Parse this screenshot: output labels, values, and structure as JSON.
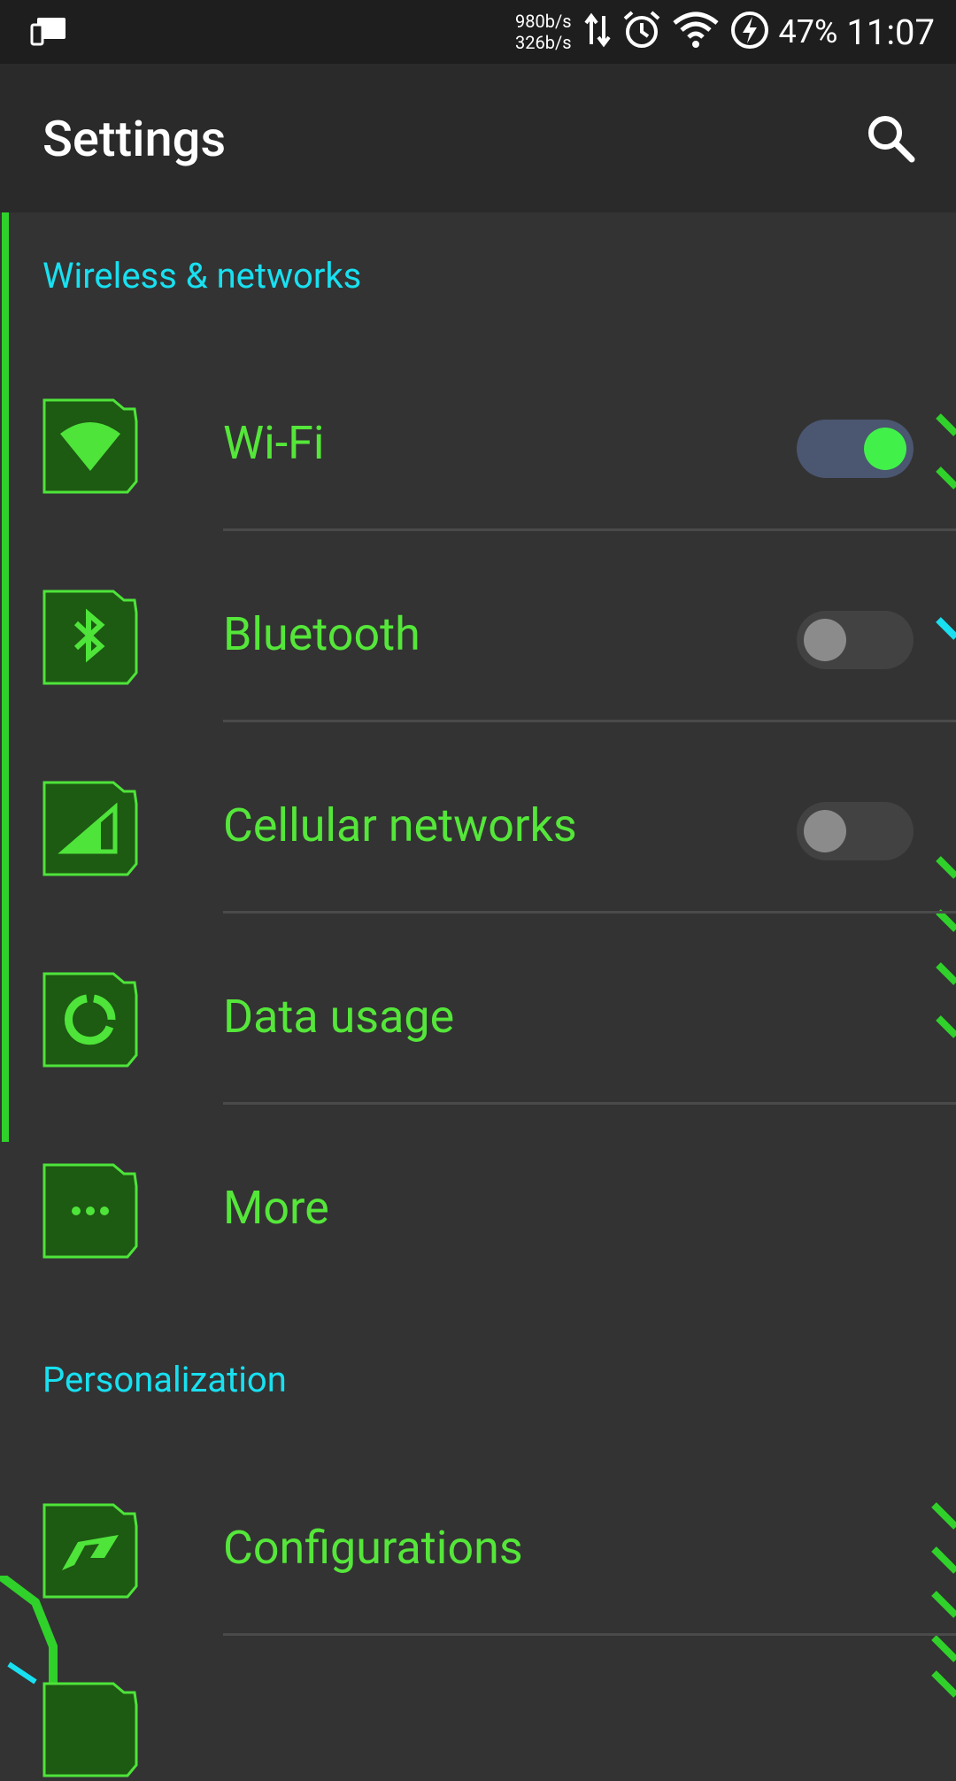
{
  "status_bar": {
    "speed_up": "980b/s",
    "speed_down": "326b/s",
    "battery": "47%",
    "time": "11:07",
    "icons": [
      "screen-cast-icon",
      "data-transfer-icon",
      "alarm-icon",
      "wifi-signal-icon",
      "charging-icon"
    ]
  },
  "app_bar": {
    "title": "Settings",
    "search_icon": "search-icon"
  },
  "sections": {
    "wireless": {
      "header": "Wireless & networks",
      "items": [
        {
          "label": "Wi-Fi",
          "icon": "wifi-icon",
          "toggle": true,
          "state": "on"
        },
        {
          "label": "Bluetooth",
          "icon": "bluetooth-icon",
          "toggle": true,
          "state": "off"
        },
        {
          "label": "Cellular networks",
          "icon": "cellular-signal-icon",
          "toggle": true,
          "state": "off"
        },
        {
          "label": "Data usage",
          "icon": "data-usage-icon"
        },
        {
          "label": "More",
          "icon": "more-icon"
        }
      ]
    },
    "personalization": {
      "header": "Personalization",
      "items": [
        {
          "label": "Configurations",
          "icon": "configurations-icon"
        }
      ]
    }
  },
  "colors": {
    "background": "#333333",
    "app_bar": "#2a2a2a",
    "status_bar": "#1e1e1e",
    "accent_green": "#55e63a",
    "section_header": "#18e0f0",
    "toggle_on_track": "#4b5670",
    "toggle_on_knob": "#41f14a"
  }
}
